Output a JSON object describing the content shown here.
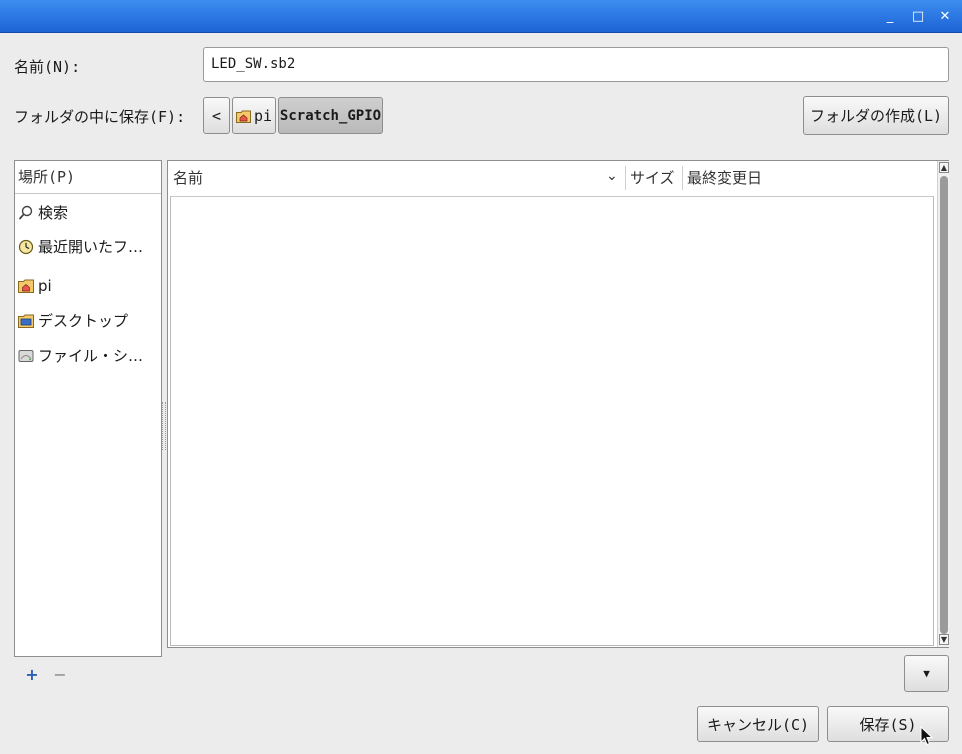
{
  "window": {
    "minimize_glyph": "_",
    "maximize_glyph": "□",
    "close_glyph": "✕"
  },
  "name_row": {
    "label": "名前(N):",
    "value": "LED_SW.sb2"
  },
  "folder_row": {
    "label": "フォルダの中に保存(F):",
    "back_glyph": "<",
    "path": [
      {
        "label": "pi",
        "icon": "home-folder-icon"
      },
      {
        "label": "Scratch_GPIO",
        "icon": "none"
      }
    ],
    "create_folder_label": "フォルダの作成(L)"
  },
  "places": {
    "header": "場所(P)",
    "items": [
      {
        "label": "検索",
        "icon": "search-icon"
      },
      {
        "label": "最近開いたフ…",
        "icon": "recent-clock-icon"
      },
      {
        "label": "pi",
        "icon": "home-folder-icon"
      },
      {
        "label": "デスクトップ",
        "icon": "desktop-folder-icon"
      },
      {
        "label": "ファイル・シ…",
        "icon": "filesystem-drive-icon"
      }
    ],
    "add_glyph": "+",
    "remove_glyph": "−"
  },
  "file_list": {
    "columns": [
      {
        "label": "名前"
      },
      {
        "label": "サイズ"
      },
      {
        "label": "最終変更日"
      }
    ],
    "sort_glyph": "⌄",
    "rows": []
  },
  "filter_glyph": "▼",
  "buttons": {
    "cancel": "キャンセル(C)",
    "save": "保存(S)"
  }
}
